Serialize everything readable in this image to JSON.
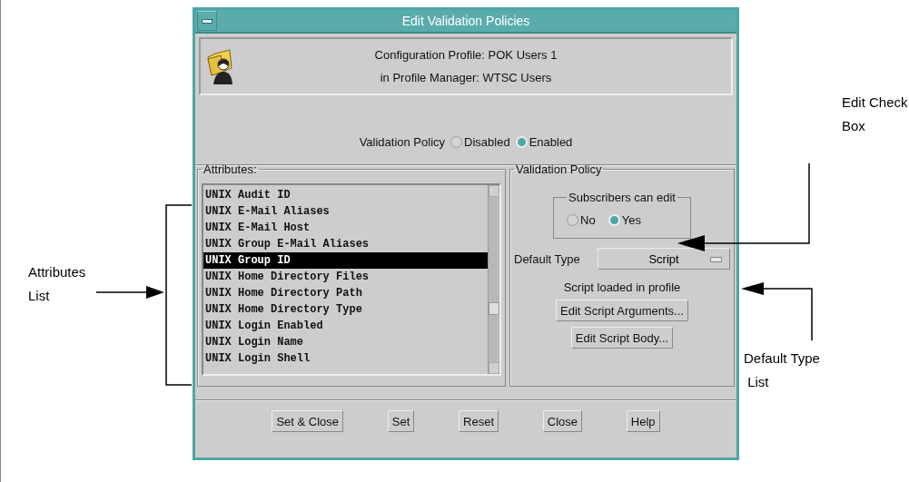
{
  "window": {
    "title": "Edit Validation Policies"
  },
  "header": {
    "lines": [
      "Configuration Profile: POK Users 1",
      "in Profile Manager: WTSC Users"
    ]
  },
  "validation_policy": {
    "label": "Validation Policy",
    "options": [
      {
        "label": "Disabled",
        "selected": false
      },
      {
        "label": "Enabled",
        "selected": true
      }
    ]
  },
  "attributes": {
    "label": "Attributes:",
    "items": [
      {
        "label": "UNIX Audit ID",
        "selected": false
      },
      {
        "label": "UNIX E-Mail Aliases",
        "selected": false
      },
      {
        "label": "UNIX E-Mail Host",
        "selected": false
      },
      {
        "label": "UNIX Group E-Mail Aliases",
        "selected": false
      },
      {
        "label": "UNIX Group ID",
        "selected": true
      },
      {
        "label": "UNIX Home Directory Files",
        "selected": false
      },
      {
        "label": "UNIX Home Directory Path",
        "selected": false
      },
      {
        "label": "UNIX Home Directory Type",
        "selected": false
      },
      {
        "label": "UNIX Login Enabled",
        "selected": false
      },
      {
        "label": "UNIX Login Name",
        "selected": false
      },
      {
        "label": "UNIX Login Shell",
        "selected": false
      }
    ]
  },
  "policy_group": {
    "label": "Validation Policy",
    "subscribers": {
      "label": "Subscribers can edit",
      "options": [
        {
          "label": "No",
          "selected": false
        },
        {
          "label": "Yes",
          "selected": true
        }
      ]
    },
    "default_type": {
      "label": "Default Type",
      "value": "Script"
    },
    "status": "Script loaded in profile",
    "buttons": [
      "Edit Script Arguments...",
      "Edit Script Body..."
    ]
  },
  "buttons": [
    "Set & Close",
    "Set",
    "Reset",
    "Close",
    "Help"
  ],
  "annotations": [
    {
      "text": "Attributes\nList"
    },
    {
      "text": "Edit Check\nBox"
    },
    {
      "text": "Default Type\n List"
    }
  ]
}
